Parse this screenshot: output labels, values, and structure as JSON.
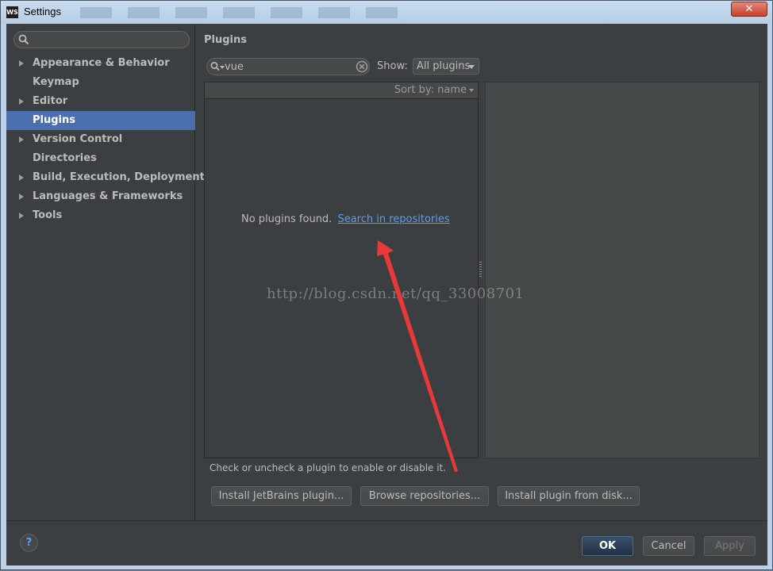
{
  "window": {
    "title": "Settings",
    "app_icon_text": "WS",
    "close_glyph": "✕"
  },
  "sidebar": {
    "search_placeholder": "",
    "items": [
      {
        "label": "Appearance & Behavior",
        "expandable": true
      },
      {
        "label": "Keymap",
        "expandable": false
      },
      {
        "label": "Editor",
        "expandable": true
      },
      {
        "label": "Plugins",
        "expandable": false,
        "selected": true
      },
      {
        "label": "Version Control",
        "expandable": true
      },
      {
        "label": "Directories",
        "expandable": false
      },
      {
        "label": "Build, Execution, Deployment",
        "expandable": true
      },
      {
        "label": "Languages & Frameworks",
        "expandable": true
      },
      {
        "label": "Tools",
        "expandable": true
      }
    ]
  },
  "plugins": {
    "title": "Plugins",
    "filter_value": "vue",
    "show_label": "Show:",
    "show_value": "All plugins",
    "sort_label": "Sort by: name",
    "empty_text": "No plugins found.",
    "empty_link": "Search in repositories",
    "hint": "Check or uncheck a plugin to enable or disable it.",
    "buttons": {
      "install_jetbrains": "Install JetBrains plugin...",
      "browse_repos": "Browse repositories...",
      "install_disk": "Install plugin from disk..."
    }
  },
  "footer": {
    "help_glyph": "?",
    "ok": "OK",
    "cancel": "Cancel",
    "apply": "Apply"
  },
  "watermark": "http://blog.csdn.net/qq_33008701",
  "colors": {
    "selection": "#4b6eaf",
    "link": "#589df6",
    "annotation_arrow": "#e8393a",
    "background": "#3c3f41"
  }
}
